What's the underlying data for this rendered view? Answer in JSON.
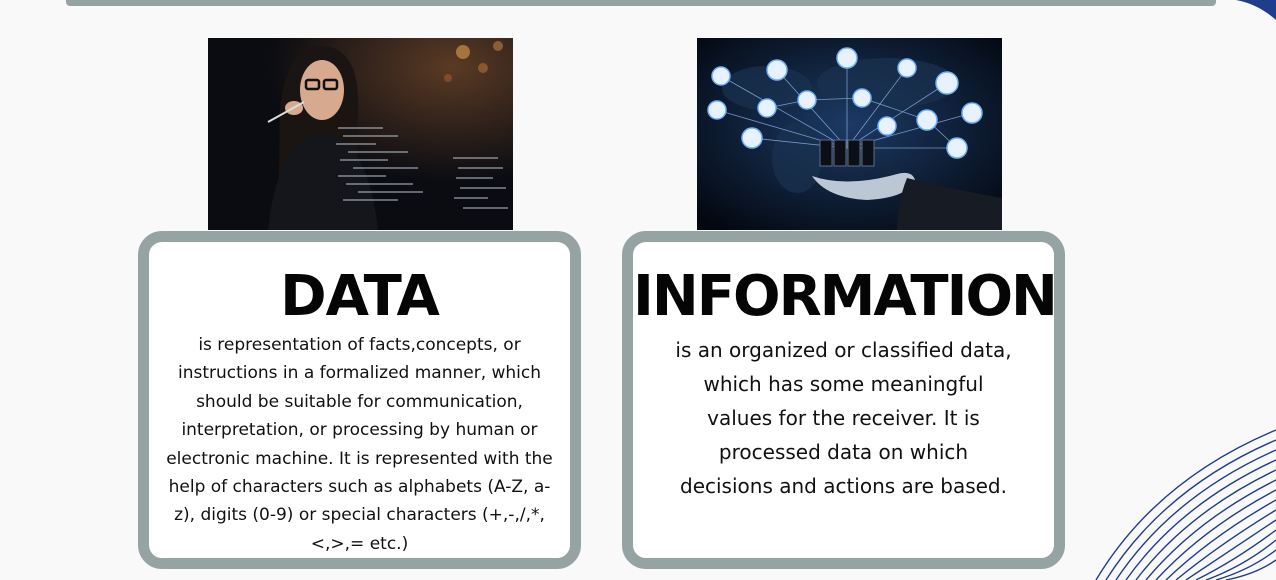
{
  "data_card": {
    "title": "DATA",
    "text": "is representation of facts,concepts, or instructions in a formalized manner, which should be suitable for communication, interpretation, or processing by human or electronic machine. It is represented with the help of characters such as alphabets (A-Z, a- z), digits (0-9) or special characters (+,-,/,*,<,>,= etc.)"
  },
  "information_card": {
    "title": "INFORMATION",
    "text": "is an organized or classified data, which has some meaningful values for the receiver. It is processed data on which decisions and actions are based."
  },
  "images": {
    "data_photo": "woman-with-glasses-viewing-code-screen",
    "information_photo": "hand-holding-network-of-device-icons"
  },
  "colors": {
    "frame": "#96a3a3",
    "background": "#f9f9fa",
    "title": "#050505",
    "accent": "#1f3d8a"
  }
}
